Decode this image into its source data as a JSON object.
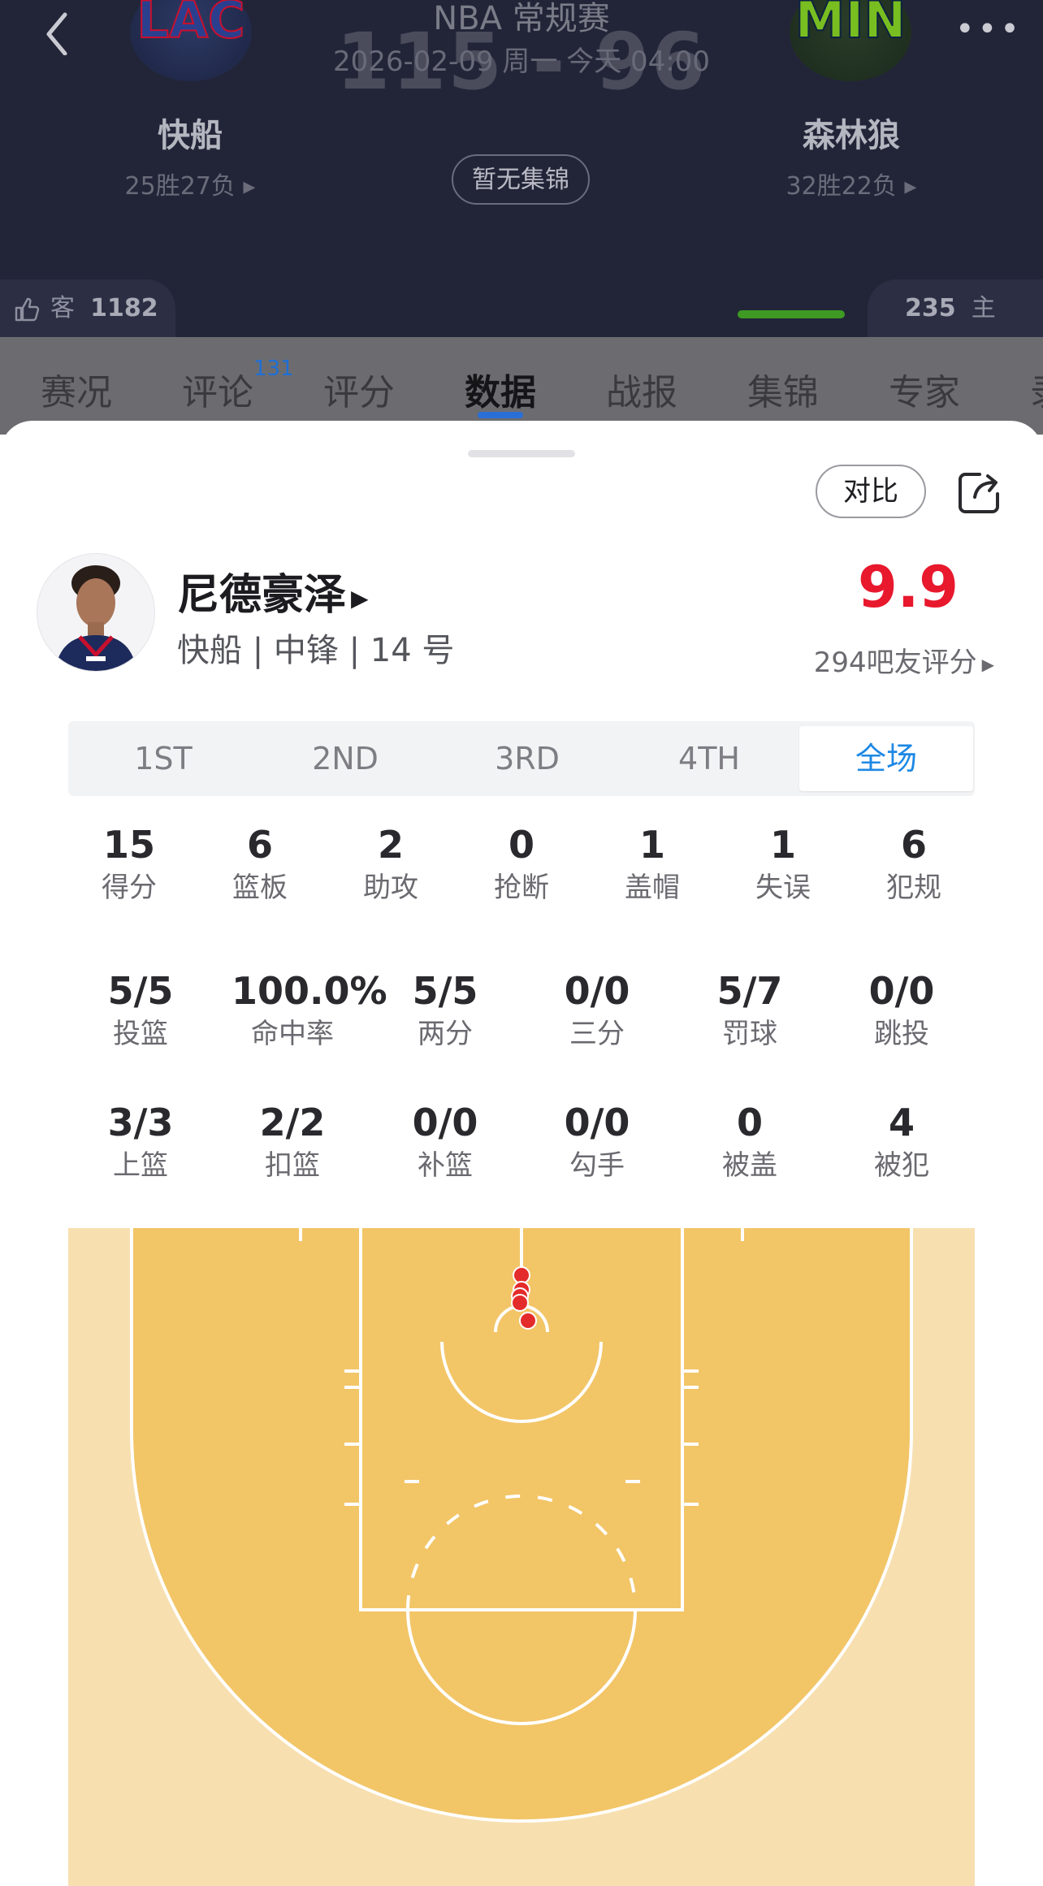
{
  "header": {
    "league": "NBA 常规赛",
    "datetime": "2026-02-09 周一 今天 04:00",
    "score": "115 - 96",
    "highlight_label": "暂无集锦",
    "away": {
      "abbr": "LAC",
      "name": "快船",
      "record": "25胜27负 ▸",
      "like_label": "客",
      "likes": "1182"
    },
    "home": {
      "abbr": "MIN",
      "name": "森林狼",
      "record": "32胜22负 ▸",
      "like_label": "主",
      "likes": "235"
    }
  },
  "tabs": [
    {
      "label": "赛况"
    },
    {
      "label": "评论",
      "badge": "131"
    },
    {
      "label": "评分"
    },
    {
      "label": "数据"
    },
    {
      "label": "战报"
    },
    {
      "label": "集锦"
    },
    {
      "label": "专家"
    },
    {
      "label": "录"
    }
  ],
  "sheet": {
    "compare_label": "对比",
    "player": {
      "name": "尼德豪泽",
      "meta": "快船 | 中锋 | 14 号",
      "rating": "9.9",
      "rating_count": "294吧友评分"
    },
    "periods": [
      "1ST",
      "2ND",
      "3RD",
      "4TH",
      "全场"
    ],
    "active_period": "全场",
    "main_stats": [
      {
        "value": "15",
        "label": "得分"
      },
      {
        "value": "6",
        "label": "篮板"
      },
      {
        "value": "2",
        "label": "助攻"
      },
      {
        "value": "0",
        "label": "抢断"
      },
      {
        "value": "1",
        "label": "盖帽"
      },
      {
        "value": "1",
        "label": "失误"
      },
      {
        "value": "6",
        "label": "犯规"
      }
    ],
    "shooting_stats": [
      {
        "value": "5/5",
        "label": "投篮"
      },
      {
        "value": "100.0%",
        "label": "命中率"
      },
      {
        "value": "5/5",
        "label": "两分"
      },
      {
        "value": "0/0",
        "label": "三分"
      },
      {
        "value": "5/7",
        "label": "罚球"
      },
      {
        "value": "0/0",
        "label": "跳投"
      }
    ],
    "shot_type_stats": [
      {
        "value": "3/3",
        "label": "上篮"
      },
      {
        "value": "2/2",
        "label": "扣篮"
      },
      {
        "value": "0/0",
        "label": "补篮"
      },
      {
        "value": "0/0",
        "label": "勾手"
      },
      {
        "value": "0",
        "label": "被盖"
      },
      {
        "value": "4",
        "label": "被犯"
      }
    ]
  },
  "colors": {
    "rating": "#e8182d",
    "active_tab": "#1e88e5",
    "court_outer": "#f7dfb0",
    "court_inner": "#f2c567",
    "made_shot": "#e42b2b"
  }
}
